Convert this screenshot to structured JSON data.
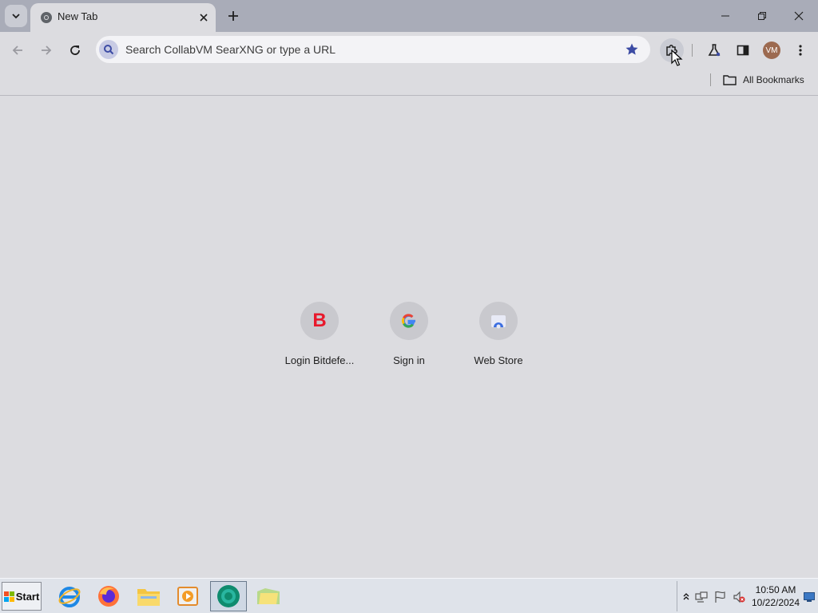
{
  "tabstrip": {
    "tabs": [
      {
        "title": "New Tab",
        "active": true
      }
    ]
  },
  "omnibox": {
    "placeholder": "Search CollabVM SearXNG or type a URL"
  },
  "bookmarks_bar": {
    "all_bookmarks_label": "All Bookmarks"
  },
  "profile": {
    "initials": "VM",
    "color": "#9c6a50"
  },
  "shortcuts": [
    {
      "label": "Login Bitdefe...",
      "icon": "bitdefender-icon",
      "letter": "B"
    },
    {
      "label": "Sign in",
      "icon": "google-icon"
    },
    {
      "label": "Web Store",
      "icon": "chrome-web-store-icon"
    }
  ],
  "taskbar": {
    "start_label": "Start",
    "apps": [
      "internet-explorer-icon",
      "firefox-icon",
      "file-explorer-icon",
      "media-player-icon",
      "chrome-browser-icon",
      "desktop-folder-icon"
    ],
    "clock_time": "10:50 AM",
    "clock_date": "10/22/2024"
  },
  "colors": {
    "tabstrip_bg": "#a9acb8",
    "page_bg": "#dcdce0",
    "omnibox_bg": "#f3f3f6",
    "accent": "#3c4ba4"
  }
}
